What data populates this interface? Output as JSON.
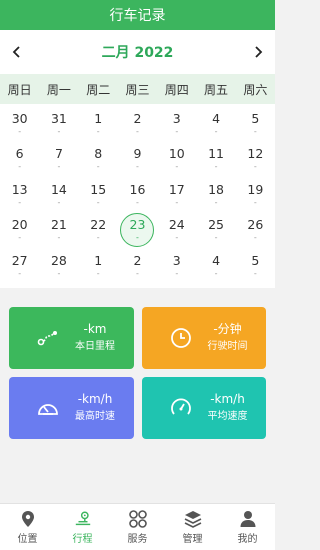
{
  "header": {
    "title": "行车记录"
  },
  "calendar": {
    "month_title": "二月 2022",
    "weekdays": [
      "周日",
      "周一",
      "周二",
      "周三",
      "周四",
      "周五",
      "周六"
    ],
    "dash": "-",
    "weeks": [
      [
        "30",
        "31",
        "1",
        "2",
        "3",
        "4",
        "5"
      ],
      [
        "6",
        "7",
        "8",
        "9",
        "10",
        "11",
        "12"
      ],
      [
        "13",
        "14",
        "15",
        "16",
        "17",
        "18",
        "19"
      ],
      [
        "20",
        "21",
        "22",
        "23",
        "24",
        "25",
        "26"
      ],
      [
        "27",
        "28",
        "1",
        "2",
        "3",
        "4",
        "5"
      ]
    ],
    "today": "23"
  },
  "stats": [
    {
      "value": "-km",
      "label": "本日里程",
      "icon": "route-icon",
      "color": "#3cb85c"
    },
    {
      "value": "-分钟",
      "label": "行驶时间",
      "icon": "clock-icon",
      "color": "#f5a623"
    },
    {
      "value": "-km/h",
      "label": "最高时速",
      "icon": "speedometer-icon",
      "color": "#6a7cf0"
    },
    {
      "value": "-km/h",
      "label": "平均速度",
      "icon": "gauge-icon",
      "color": "#1fc4b0"
    }
  ],
  "tabbar": {
    "items": [
      {
        "label": "位置",
        "icon": "location-pin-icon"
      },
      {
        "label": "行程",
        "icon": "trip-icon"
      },
      {
        "label": "服务",
        "icon": "services-grid-icon"
      },
      {
        "label": "管理",
        "icon": "layers-icon"
      },
      {
        "label": "我的",
        "icon": "user-icon"
      }
    ],
    "active": "行程",
    "active_color": "#3cb55e"
  }
}
